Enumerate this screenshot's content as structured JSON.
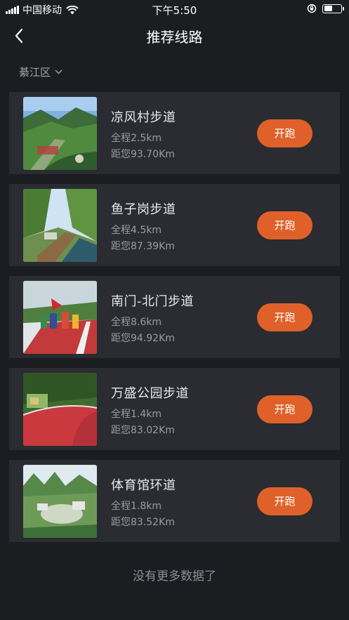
{
  "status_bar": {
    "carrier": "中国移动",
    "time": "下午5:50"
  },
  "nav": {
    "title": "推荐线路"
  },
  "filter": {
    "district": "綦江区"
  },
  "routes": [
    {
      "name": "凉风村步道",
      "length": "全程2.5km",
      "distance": "距您93.70Km",
      "button": "开跑"
    },
    {
      "name": "鱼子岗步道",
      "length": "全程4.5km",
      "distance": "距您87.39Km",
      "button": "开跑"
    },
    {
      "name": "南门-北门步道",
      "length": "全程8.6km",
      "distance": "距您94.92Km",
      "button": "开跑"
    },
    {
      "name": "万盛公园步道",
      "length": "全程1.4km",
      "distance": "距您83.02Km",
      "button": "开跑"
    },
    {
      "name": "体育馆环道",
      "length": "全程1.8km",
      "distance": "距您83.52Km",
      "button": "开跑"
    }
  ],
  "footer": {
    "no_more": "没有更多数据了"
  },
  "colors": {
    "background": "#1c1d21",
    "card": "#2a2c31",
    "accent": "#df6129"
  }
}
